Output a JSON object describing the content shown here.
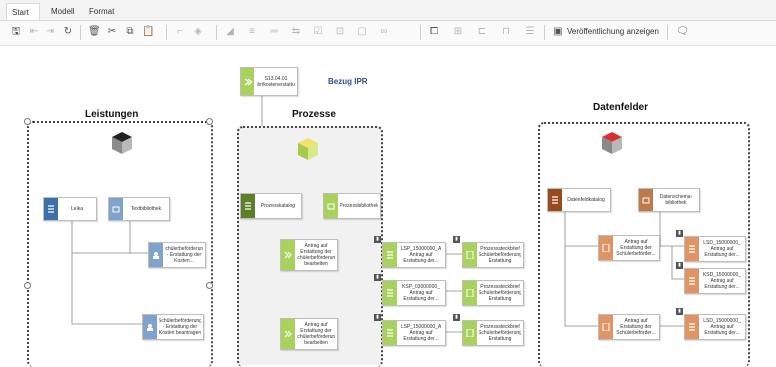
{
  "menu": {
    "tabs": [
      "Start",
      "Modell",
      "Format"
    ],
    "active": "Start"
  },
  "toolbar": {
    "publish_label": "Veröffentlichung anzeigen"
  },
  "diagram": {
    "top_node": "S13.04.01 Fahrtkostenerstattung",
    "reference_label": "Bezug IPR",
    "lanes": {
      "leistungen": "Leistungen",
      "prozesse": "Prozesse",
      "datenfelder": "Datenfelder"
    },
    "leistungen": {
      "nodes": [
        "Leika",
        "Textbibliothek",
        "Schülerbeförderung - Erstattung der Kosten...",
        "Schülerbeförderung - Erstattung der Kosten beantragen"
      ]
    },
    "prozesse": {
      "nodes": [
        "Prozesskatalog",
        "Prozessbibliothek",
        "Antrag auf Erstattung der Schülerbeförderung bearbeiten",
        "Antrag auf Erstattung der Schülerbeförderung bearbeiten",
        "LSP_15000000_A Antrag auf Erstattung der...",
        "KSP_03000000_ Antrag auf Erstattung der...",
        "LSP_15000000_A Antrag auf Erstattung der...",
        "Prozesssteckbrief Schülerbeförderung Erstattung",
        "Prozesssteckbrief Schülerbeförderung Erstattung",
        "Prozesssteckbrief Schülerbeförderung Erstattung"
      ]
    },
    "datenfelder": {
      "nodes": [
        "Datenfeldkatalog",
        "Datenschema-bibliothek",
        "Antrag auf Erstattung der Schülerbeförder...",
        "Antrag auf Erstattung der Schülerbeförder...",
        "LSD_15000000_ Antrag auf Erstattung der...",
        "KSD_15000000_ Antrag auf Erstattung der...",
        "LSD_15000000_ Antrag auf Erstattung der..."
      ]
    },
    "colors": {
      "leistungen_accent": "#3d6fa8",
      "prozesse_dark": "#5c7f2a",
      "prozesse_light": "#a8d25b",
      "datenfelder_dark": "#9a4a1f",
      "datenfelder_light": "#e09464"
    },
    "icons": [
      "undo-icon",
      "redo-icon",
      "refresh-icon",
      "delete-icon",
      "cut-icon",
      "copy-icon",
      "paste-icon",
      "publish-icon"
    ]
  }
}
